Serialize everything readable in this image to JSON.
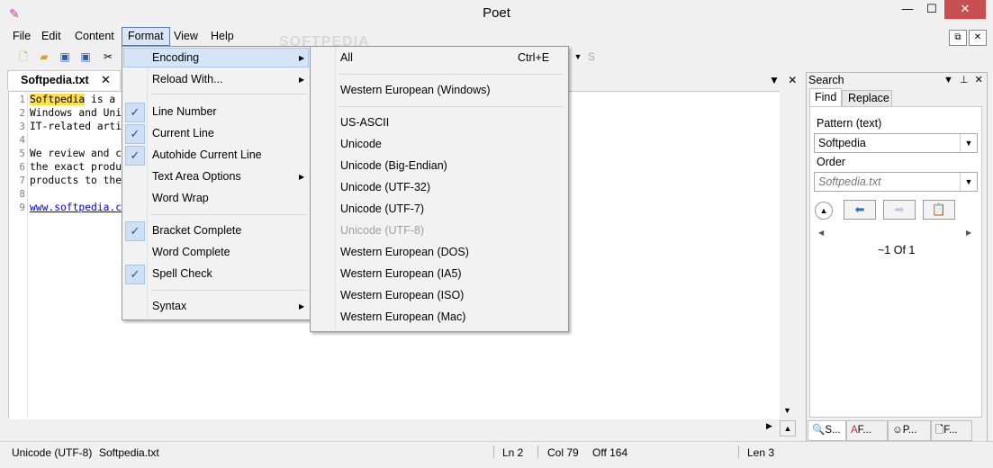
{
  "window": {
    "title": "Poet"
  },
  "menubar": {
    "items": [
      "File",
      "Edit",
      "Content",
      "Format",
      "View",
      "Help"
    ]
  },
  "toolbar": {
    "font_letter": "S"
  },
  "editor": {
    "tab_label": "Softpedia.txt",
    "lines": [
      {
        "no": "1",
        "highlight": "Softpedia",
        "text": " is a"
      },
      {
        "no": "2",
        "text": "Windows and Uni"
      },
      {
        "no": "3",
        "text": "IT-related arti"
      },
      {
        "no": "4",
        "text": ""
      },
      {
        "no": "5",
        "text": "We review and c"
      },
      {
        "no": "6",
        "text": "the exact produ"
      },
      {
        "no": "7",
        "text": "products to the"
      },
      {
        "no": "8",
        "text": ""
      },
      {
        "no": "9",
        "link": "www.softpedia.co"
      }
    ]
  },
  "format_menu": {
    "items": [
      {
        "label": "Encoding",
        "submenu": true,
        "checked": false
      },
      {
        "label": "Reload With...",
        "submenu": true,
        "checked": false
      },
      {
        "label": "Line Number",
        "checked": true
      },
      {
        "label": "Current Line",
        "checked": true
      },
      {
        "label": "Autohide Current Line",
        "checked": true
      },
      {
        "label": "Text Area Options",
        "submenu": true,
        "checked": false
      },
      {
        "label": "Word Wrap",
        "checked": false
      },
      {
        "label": "Bracket Complete",
        "checked": true
      },
      {
        "label": "Word Complete",
        "checked": false
      },
      {
        "label": "Spell Check",
        "checked": true
      },
      {
        "label": "Syntax",
        "submenu": true,
        "checked": false
      }
    ]
  },
  "encoding_menu": {
    "all_label": "All",
    "all_shortcut": "Ctrl+E",
    "items": [
      "Western European (Windows)",
      "US-ASCII",
      "Unicode",
      "Unicode (Big-Endian)",
      "Unicode (UTF-32)",
      "Unicode (UTF-7)",
      "Unicode (UTF-8)",
      "Western European (DOS)",
      "Western European (IA5)",
      "Western European (ISO)",
      "Western European (Mac)"
    ],
    "disabled_item": "Unicode (UTF-8)"
  },
  "search_panel": {
    "title": "Search",
    "tabs": [
      "Find",
      "Replace"
    ],
    "pattern_label": "Pattern (text)",
    "pattern_value": "Softpedia",
    "order_label": "Order",
    "order_value": "Softpedia.txt",
    "result": "~1 Of 1",
    "bottom_tabs": [
      "S...",
      "F...",
      "P...",
      "F..."
    ]
  },
  "statusbar": {
    "encoding": "Unicode (UTF-8)",
    "filename": "Softpedia.txt",
    "line": "Ln 2",
    "col": "Col 79",
    "off": "Off 164",
    "len": "Len 3"
  },
  "watermark": "SOFTPEDIA",
  "colors": {
    "highlight": "#ffe04a",
    "close_button": "#c74f4f",
    "check_bg": "#cfe0f5"
  }
}
